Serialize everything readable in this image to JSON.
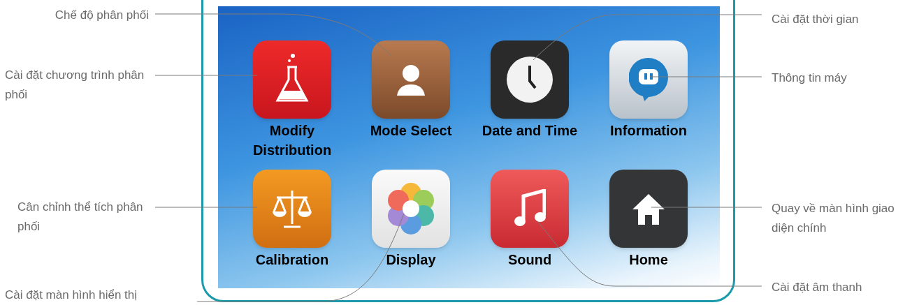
{
  "apps": [
    {
      "kind": "flask",
      "label": "Modify Distribution"
    },
    {
      "kind": "person",
      "label": "Mode Select"
    },
    {
      "kind": "clock",
      "label": "Date and Time"
    },
    {
      "kind": "chat",
      "label": "Information"
    },
    {
      "kind": "scales",
      "label": "Calibration"
    },
    {
      "kind": "flower",
      "label": "Display"
    },
    {
      "kind": "note",
      "label": "Sound"
    },
    {
      "kind": "house",
      "label": "Home"
    }
  ],
  "callouts": [
    {
      "text": "Chế độ phân phối"
    },
    {
      "text": "Cài đặt chương trình phân phối"
    },
    {
      "text": "Cân chỉnh thể tích phân phối"
    },
    {
      "text": "Cài đặt màn hình hiển thị"
    },
    {
      "text": "Cài đặt thời gian"
    },
    {
      "text": "Thông tin máy"
    },
    {
      "text": "Quay về màn hình giao diện chính"
    },
    {
      "text": "Cài đặt âm thanh"
    }
  ]
}
